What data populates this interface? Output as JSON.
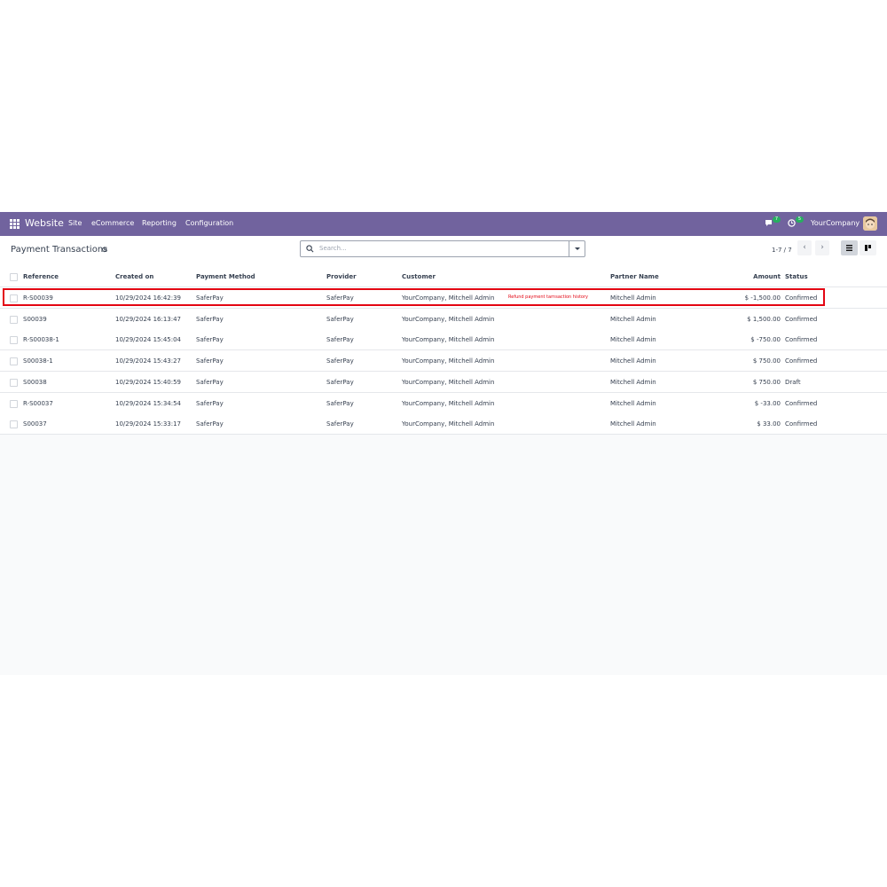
{
  "navbar": {
    "app_name": "Website",
    "menu": [
      "Site",
      "eCommerce",
      "Reporting",
      "Configuration"
    ],
    "messages_count": "7",
    "activities_count": "5",
    "company": "YourCompany"
  },
  "control_panel": {
    "title": "Payment Transactions",
    "search_placeholder": "Search...",
    "pager": "1-7 / 7"
  },
  "table": {
    "columns": [
      "Reference",
      "Created on",
      "Payment Method",
      "Provider",
      "Customer",
      "Partner Name",
      "Amount",
      "Status"
    ],
    "rows": [
      {
        "reference": "R-S00039",
        "created_on": "10/29/2024 16:42:39",
        "method": "SaferPay",
        "provider": "SaferPay",
        "customer": "YourCompany, Mitchell Admin",
        "partner": "Mitchell Admin",
        "amount": "$ -1,500.00",
        "status": "Confirmed"
      },
      {
        "reference": "S00039",
        "created_on": "10/29/2024 16:13:47",
        "method": "SaferPay",
        "provider": "SaferPay",
        "customer": "YourCompany, Mitchell Admin",
        "partner": "Mitchell Admin",
        "amount": "$ 1,500.00",
        "status": "Confirmed"
      },
      {
        "reference": "R-S00038-1",
        "created_on": "10/29/2024 15:45:04",
        "method": "SaferPay",
        "provider": "SaferPay",
        "customer": "YourCompany, Mitchell Admin",
        "partner": "Mitchell Admin",
        "amount": "$ -750.00",
        "status": "Confirmed"
      },
      {
        "reference": "S00038-1",
        "created_on": "10/29/2024 15:43:27",
        "method": "SaferPay",
        "provider": "SaferPay",
        "customer": "YourCompany, Mitchell Admin",
        "partner": "Mitchell Admin",
        "amount": "$ 750.00",
        "status": "Confirmed"
      },
      {
        "reference": "S00038",
        "created_on": "10/29/2024 15:40:59",
        "method": "SaferPay",
        "provider": "SaferPay",
        "customer": "YourCompany, Mitchell Admin",
        "partner": "Mitchell Admin",
        "amount": "$ 750.00",
        "status": "Draft"
      },
      {
        "reference": "R-S00037",
        "created_on": "10/29/2024 15:34:54",
        "method": "SaferPay",
        "provider": "SaferPay",
        "customer": "YourCompany, Mitchell Admin",
        "partner": "Mitchell Admin",
        "amount": "$ -33.00",
        "status": "Confirmed"
      },
      {
        "reference": "S00037",
        "created_on": "10/29/2024 15:33:17",
        "method": "SaferPay",
        "provider": "SaferPay",
        "customer": "YourCompany, Mitchell Admin",
        "partner": "Mitchell Admin",
        "amount": "$ 33.00",
        "status": "Confirmed"
      }
    ]
  },
  "annotation": "Refund payment tarnsaction history",
  "colors": {
    "navbar": "#71639e",
    "highlight": "#e30613",
    "badge": "#27ae60"
  }
}
